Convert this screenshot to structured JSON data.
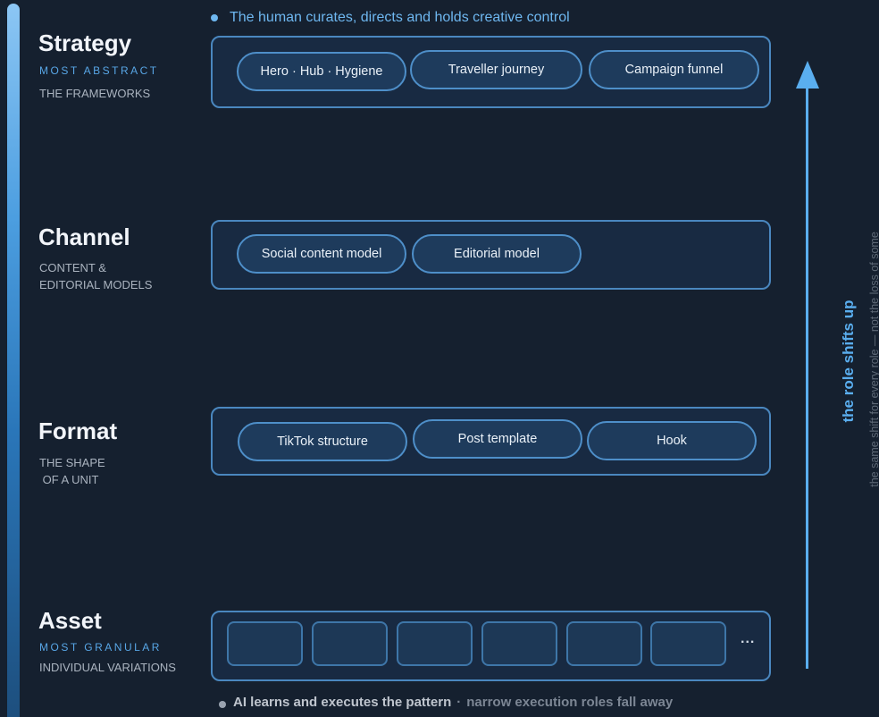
{
  "top_note": "The human curates, directs and holds creative control",
  "levels": {
    "strategy": {
      "title": "Strategy",
      "tag": "MOST ABSTRACT",
      "desc": "THE FRAMEWORKS",
      "items": [
        "Hero · Hub · Hygiene",
        "Traveller journey",
        "Campaign funnel"
      ]
    },
    "channel": {
      "title": "Channel",
      "desc": "CONTENT &\nEDITORIAL MODELS",
      "items": [
        "Social content model",
        "Editorial model"
      ]
    },
    "format": {
      "title": "Format",
      "desc": "THE SHAPE\n OF A UNIT",
      "items": [
        "TikTok structure",
        "Post template",
        "Hook"
      ]
    },
    "asset": {
      "title": "Asset",
      "tag": "MOST GRANULAR",
      "desc": "INDIVIDUAL VARIATIONS",
      "more": "..."
    }
  },
  "bottom_note": {
    "strong": "AI learns and executes the pattern",
    "separator": "·",
    "rest": "narrow execution roles fall away"
  },
  "side": {
    "main": "the role shifts up",
    "sub": "the same shift for every role — not the loss of some"
  },
  "colors": {
    "background": "#15202f",
    "accent": "#5aaeef",
    "panel_border": "#4a87bf",
    "pill_fill": "#1e3b5c"
  }
}
